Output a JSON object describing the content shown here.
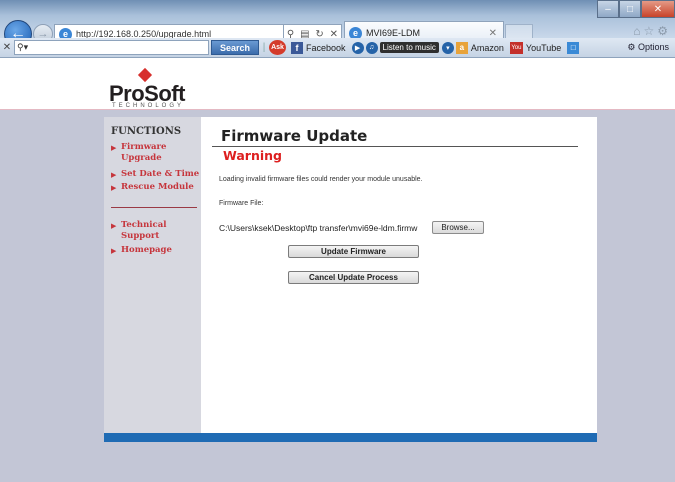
{
  "browser": {
    "address": "http://192.168.0.250/upgrade.html",
    "tab_title": "MVI69E-LDM",
    "window_min": "–",
    "window_max": "□",
    "window_close": "✕"
  },
  "toolbar": {
    "search_button": "Search",
    "facebook": "Facebook",
    "music": "Listen to music",
    "amazon": "Amazon",
    "youtube": "YouTube",
    "options": "Options"
  },
  "logo": {
    "name": "ProSoft",
    "sub": "TECHNOLOGY"
  },
  "sidebar": {
    "heading": "FUNCTIONS",
    "items": [
      {
        "label": "Firmware Upgrade"
      },
      {
        "label": "Set Date & Time"
      },
      {
        "label": "Rescue Module"
      },
      {
        "label": "Technical Support"
      },
      {
        "label": "Homepage"
      }
    ]
  },
  "main": {
    "title": "Firmware Update",
    "warning": "Warning",
    "warning_message": "Loading invalid firmware files could render your module unusable.",
    "file_label": "Firmware File:",
    "file_path": "C:\\Users\\ksek\\Desktop\\ftp transfer\\mvi69e-ldm.firmw",
    "browse": "Browse...",
    "update_button": "Update Firmware",
    "cancel_button": "Cancel Update Process"
  },
  "colors": {
    "accent_red": "#dd1f1f",
    "footer_blue": "#1f6bb4",
    "page_grey": "#c3c6d6"
  }
}
